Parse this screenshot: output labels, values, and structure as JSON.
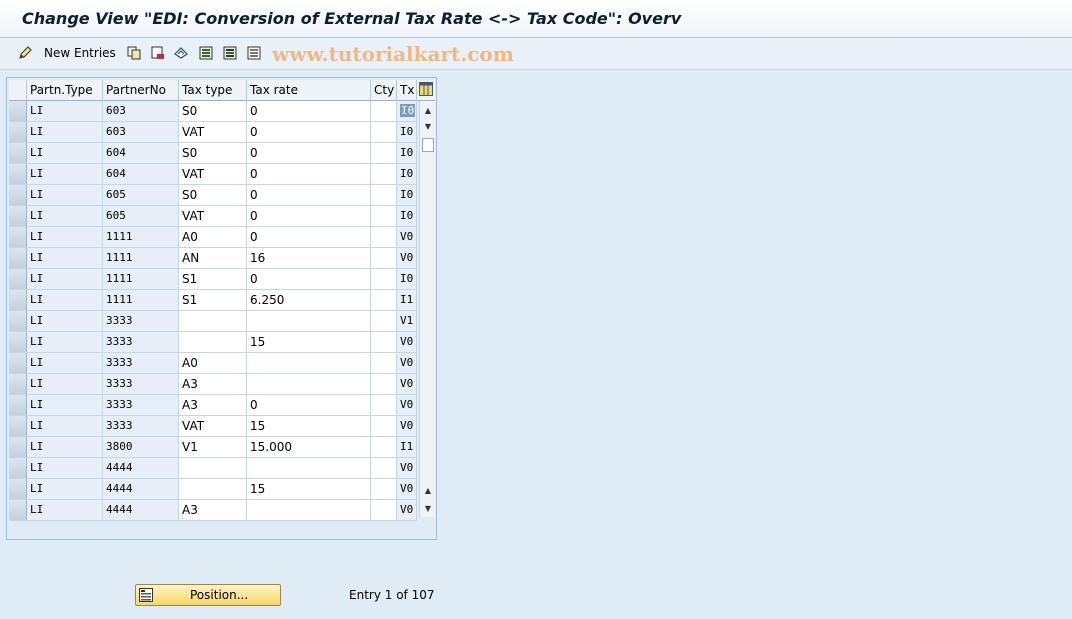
{
  "window": {
    "title": "Change View \"EDI: Conversion of External Tax Rate <-> Tax Code\": Overv"
  },
  "toolbar": {
    "new_entries_label": "New Entries",
    "watermark": "www.tutorialkart.com",
    "icons": [
      "pencil-icon",
      "copy-icon",
      "delete-icon",
      "undo-icon",
      "select-all-icon",
      "select-block-icon",
      "deselect-all-icon"
    ]
  },
  "table": {
    "columns": [
      "Partn.Type",
      "PartnerNo",
      "Tax type",
      "Tax rate",
      "Cty",
      "Tx"
    ],
    "rows": [
      [
        "LI",
        "603",
        "S0",
        "0",
        "",
        "I0"
      ],
      [
        "LI",
        "603",
        "VAT",
        "0",
        "",
        "I0"
      ],
      [
        "LI",
        "604",
        "S0",
        "0",
        "",
        "I0"
      ],
      [
        "LI",
        "604",
        "VAT",
        "0",
        "",
        "I0"
      ],
      [
        "LI",
        "605",
        "S0",
        "0",
        "",
        "I0"
      ],
      [
        "LI",
        "605",
        "VAT",
        "0",
        "",
        "I0"
      ],
      [
        "LI",
        "1111",
        "A0",
        "0",
        "",
        "V0"
      ],
      [
        "LI",
        "1111",
        "AN",
        "16",
        "",
        "V0"
      ],
      [
        "LI",
        "1111",
        "S1",
        "0",
        "",
        "I0"
      ],
      [
        "LI",
        "1111",
        "S1",
        "6.250",
        "",
        "I1"
      ],
      [
        "LI",
        "3333",
        "",
        "",
        "",
        "V1"
      ],
      [
        "LI",
        "3333",
        "",
        "15",
        "",
        "V0"
      ],
      [
        "LI",
        "3333",
        "A0",
        "",
        "",
        "V0"
      ],
      [
        "LI",
        "3333",
        "A3",
        "",
        "",
        "V0"
      ],
      [
        "LI",
        "3333",
        "A3",
        "0",
        "",
        "V0"
      ],
      [
        "LI",
        "3333",
        "VAT",
        "15",
        "",
        "V0"
      ],
      [
        "LI",
        "3800",
        "V1",
        "15.000",
        "",
        "I1"
      ],
      [
        "LI",
        "4444",
        "",
        "",
        "",
        "V0"
      ],
      [
        "LI",
        "4444",
        "",
        "15",
        "",
        "V0"
      ],
      [
        "LI",
        "4444",
        "A3",
        "",
        "",
        "V0"
      ]
    ]
  },
  "footer": {
    "position_button_label": "Position...",
    "entry_info": "Entry 1 of 107"
  }
}
